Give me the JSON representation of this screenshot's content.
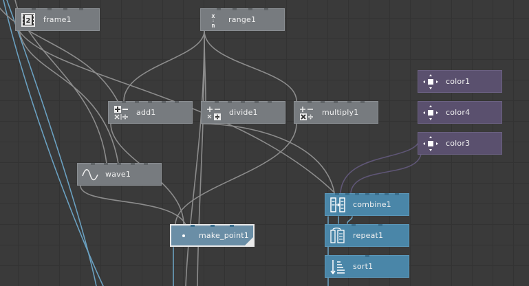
{
  "graph": {
    "nodes": [
      {
        "id": "frame1",
        "label": "frame1",
        "icon": "frame-icon",
        "color": "gray"
      },
      {
        "id": "range1",
        "label": "range1",
        "icon": "range-icon",
        "color": "gray"
      },
      {
        "id": "add1",
        "label": "add1",
        "icon": "add-icon",
        "color": "gray"
      },
      {
        "id": "divide1",
        "label": "divide1",
        "icon": "divide-icon",
        "color": "gray"
      },
      {
        "id": "multiply1",
        "label": "multiply1",
        "icon": "multiply-icon",
        "color": "gray"
      },
      {
        "id": "color1",
        "label": "color1",
        "icon": "color-icon",
        "color": "purple"
      },
      {
        "id": "color4",
        "label": "color4",
        "icon": "color-icon",
        "color": "purple"
      },
      {
        "id": "color3",
        "label": "color3",
        "icon": "color-icon",
        "color": "purple"
      },
      {
        "id": "wave1",
        "label": "wave1",
        "icon": "wave-icon",
        "color": "gray"
      },
      {
        "id": "combine1",
        "label": "combine1",
        "icon": "combine-icon",
        "color": "blue"
      },
      {
        "id": "make_point1",
        "label": "make_point1",
        "icon": "point-icon",
        "color": "blue",
        "selected": true
      },
      {
        "id": "repeat1",
        "label": "repeat1",
        "icon": "repeat-icon",
        "color": "blue"
      },
      {
        "id": "sort1",
        "label": "sort1",
        "icon": "sort-icon",
        "color": "blue"
      }
    ]
  },
  "colors": {
    "canvas_bg": "#3a3a3a",
    "grid_line": "#333333",
    "wire_gray": "#8c8c8c",
    "wire_purple": "#5f5676",
    "wire_blue": "#6aa0c0",
    "node_gray": "#777b7f",
    "node_purple": "#5a506e",
    "node_blue": "#4a86a8",
    "selection_border": "#eaeaea"
  }
}
